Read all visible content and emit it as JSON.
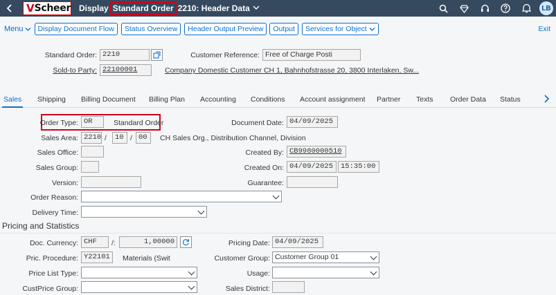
{
  "shell": {
    "logo_mark": "V",
    "logo_text": "Scheer",
    "title_prefix": "Display",
    "title_highlight": "Standard Order",
    "title_suffix": "2210: Header Data",
    "avatar_initials": "LB"
  },
  "toolbar": {
    "menu_label": "Menu",
    "buttons": [
      "Display Document Flow",
      "Status Overview",
      "Header Output Preview",
      "Output",
      "Services for Object"
    ],
    "exit_label": "Exit"
  },
  "header": {
    "standard_order_label": "Standard Order:",
    "standard_order_value": "2210",
    "customer_ref_label": "Customer Reference:",
    "customer_ref_value": "Free of Charge Posti",
    "sold_to_label": "Sold-to Party:",
    "sold_to_value": "22100001",
    "sold_to_desc": "Company Domestic Customer CH 1, Bahnhofstrasse 20, 3800 Interlaken, Sw..."
  },
  "tabs": [
    "Sales",
    "Shipping",
    "Billing Document",
    "Billing Plan",
    "Accounting",
    "Conditions",
    "Account assignment",
    "Partner",
    "Texts",
    "Order Data",
    "Status"
  ],
  "sales": {
    "order_type_label": "Order Type:",
    "order_type_value": "OR",
    "order_type_desc": "Standard Order",
    "doc_date_label": "Document Date:",
    "doc_date_value": "04/09/2025",
    "sales_area_label": "Sales Area:",
    "sales_org": "2210",
    "dist_channel": "10",
    "division": "00",
    "sales_area_desc": "CH Sales Org., Distribution Channel, Division",
    "sep": "/",
    "sales_office_label": "Sales Office:",
    "created_by_label": "Created By:",
    "created_by_value": "CB9980000510",
    "sales_group_label": "Sales Group:",
    "created_on_label": "Created On:",
    "created_on_date": "04/09/2025",
    "created_on_time": "15:35:00",
    "version_label": "Version:",
    "guarantee_label": "Guarantee:",
    "order_reason_label": "Order Reason:",
    "delivery_time_label": "Delivery Time:"
  },
  "pricing": {
    "section_title": "Pricing and Statistics",
    "doc_currency_label": "Doc. Currency:",
    "doc_currency_value": "CHF",
    "rate_sep": "/:",
    "rate_value": "1,00000",
    "pricing_date_label": "Pricing Date:",
    "pricing_date_value": "04/09/2025",
    "pric_procedure_label": "Pric. Procedure:",
    "pric_procedure_value": "Y22101",
    "pric_procedure_desc": "Materials (Swit",
    "customer_group_label": "Customer Group:",
    "customer_group_value": "Customer Group 01",
    "price_list_label": "Price List Type:",
    "usage_label": "Usage:",
    "cust_price_group_label": "CustPrice Group:",
    "sales_district_label": "Sales District:"
  }
}
